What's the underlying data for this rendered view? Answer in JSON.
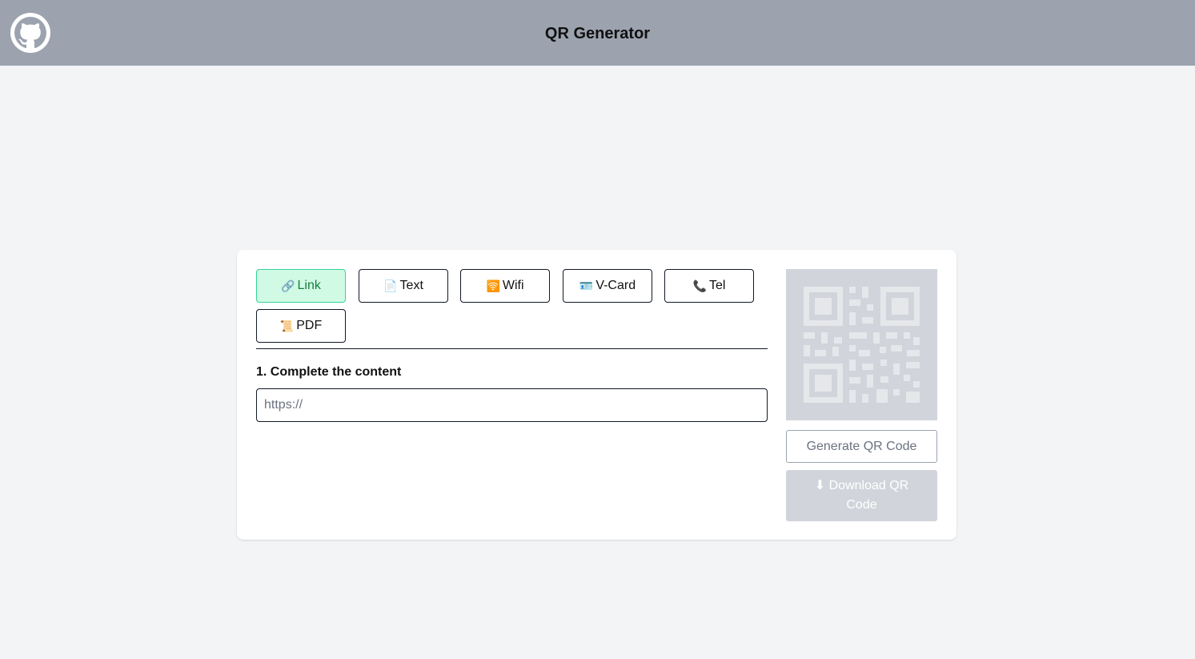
{
  "header": {
    "title": "QR Generator",
    "logo_icon": "github-icon"
  },
  "types": [
    {
      "icon": "🔗",
      "label": "Link",
      "active": true
    },
    {
      "icon": "📄",
      "label": "Text",
      "active": false
    },
    {
      "icon": "🛜",
      "label": "Wifi",
      "active": false
    },
    {
      "icon": "🪪",
      "label": "V-Card",
      "active": false
    },
    {
      "icon": "📞",
      "label": "Tel",
      "active": false
    },
    {
      "icon": "📜",
      "label": "PDF",
      "active": false
    }
  ],
  "form": {
    "step_label": "1. Complete the content",
    "input_placeholder": "https://",
    "input_value": ""
  },
  "actions": {
    "generate_label": "Generate QR Code",
    "download_icon": "⬇",
    "download_label": "Download QR Code"
  },
  "colors": {
    "header_bg": "#9ca3af",
    "page_bg": "#f3f4f6",
    "active_bg": "#d1fae5",
    "active_text": "#15803d",
    "qr_placeholder_bg": "#d1d5db"
  }
}
